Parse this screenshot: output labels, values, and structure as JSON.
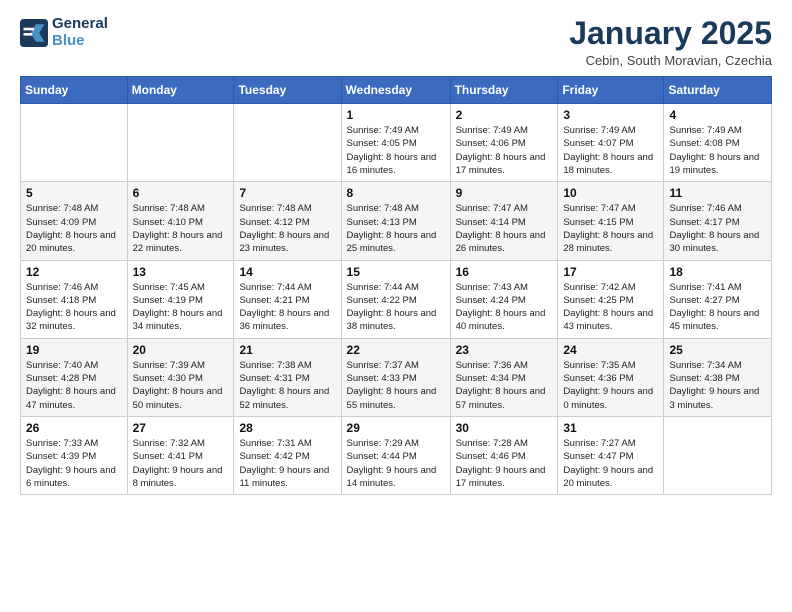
{
  "header": {
    "logo_line1": "General",
    "logo_line2": "Blue",
    "title": "January 2025",
    "subtitle": "Cebin, South Moravian, Czechia"
  },
  "weekdays": [
    "Sunday",
    "Monday",
    "Tuesday",
    "Wednesday",
    "Thursday",
    "Friday",
    "Saturday"
  ],
  "weeks": [
    [
      {
        "day": "",
        "sunrise": "",
        "sunset": "",
        "daylight": ""
      },
      {
        "day": "",
        "sunrise": "",
        "sunset": "",
        "daylight": ""
      },
      {
        "day": "",
        "sunrise": "",
        "sunset": "",
        "daylight": ""
      },
      {
        "day": "1",
        "sunrise": "Sunrise: 7:49 AM",
        "sunset": "Sunset: 4:05 PM",
        "daylight": "Daylight: 8 hours and 16 minutes."
      },
      {
        "day": "2",
        "sunrise": "Sunrise: 7:49 AM",
        "sunset": "Sunset: 4:06 PM",
        "daylight": "Daylight: 8 hours and 17 minutes."
      },
      {
        "day": "3",
        "sunrise": "Sunrise: 7:49 AM",
        "sunset": "Sunset: 4:07 PM",
        "daylight": "Daylight: 8 hours and 18 minutes."
      },
      {
        "day": "4",
        "sunrise": "Sunrise: 7:49 AM",
        "sunset": "Sunset: 4:08 PM",
        "daylight": "Daylight: 8 hours and 19 minutes."
      }
    ],
    [
      {
        "day": "5",
        "sunrise": "Sunrise: 7:48 AM",
        "sunset": "Sunset: 4:09 PM",
        "daylight": "Daylight: 8 hours and 20 minutes."
      },
      {
        "day": "6",
        "sunrise": "Sunrise: 7:48 AM",
        "sunset": "Sunset: 4:10 PM",
        "daylight": "Daylight: 8 hours and 22 minutes."
      },
      {
        "day": "7",
        "sunrise": "Sunrise: 7:48 AM",
        "sunset": "Sunset: 4:12 PM",
        "daylight": "Daylight: 8 hours and 23 minutes."
      },
      {
        "day": "8",
        "sunrise": "Sunrise: 7:48 AM",
        "sunset": "Sunset: 4:13 PM",
        "daylight": "Daylight: 8 hours and 25 minutes."
      },
      {
        "day": "9",
        "sunrise": "Sunrise: 7:47 AM",
        "sunset": "Sunset: 4:14 PM",
        "daylight": "Daylight: 8 hours and 26 minutes."
      },
      {
        "day": "10",
        "sunrise": "Sunrise: 7:47 AM",
        "sunset": "Sunset: 4:15 PM",
        "daylight": "Daylight: 8 hours and 28 minutes."
      },
      {
        "day": "11",
        "sunrise": "Sunrise: 7:46 AM",
        "sunset": "Sunset: 4:17 PM",
        "daylight": "Daylight: 8 hours and 30 minutes."
      }
    ],
    [
      {
        "day": "12",
        "sunrise": "Sunrise: 7:46 AM",
        "sunset": "Sunset: 4:18 PM",
        "daylight": "Daylight: 8 hours and 32 minutes."
      },
      {
        "day": "13",
        "sunrise": "Sunrise: 7:45 AM",
        "sunset": "Sunset: 4:19 PM",
        "daylight": "Daylight: 8 hours and 34 minutes."
      },
      {
        "day": "14",
        "sunrise": "Sunrise: 7:44 AM",
        "sunset": "Sunset: 4:21 PM",
        "daylight": "Daylight: 8 hours and 36 minutes."
      },
      {
        "day": "15",
        "sunrise": "Sunrise: 7:44 AM",
        "sunset": "Sunset: 4:22 PM",
        "daylight": "Daylight: 8 hours and 38 minutes."
      },
      {
        "day": "16",
        "sunrise": "Sunrise: 7:43 AM",
        "sunset": "Sunset: 4:24 PM",
        "daylight": "Daylight: 8 hours and 40 minutes."
      },
      {
        "day": "17",
        "sunrise": "Sunrise: 7:42 AM",
        "sunset": "Sunset: 4:25 PM",
        "daylight": "Daylight: 8 hours and 43 minutes."
      },
      {
        "day": "18",
        "sunrise": "Sunrise: 7:41 AM",
        "sunset": "Sunset: 4:27 PM",
        "daylight": "Daylight: 8 hours and 45 minutes."
      }
    ],
    [
      {
        "day": "19",
        "sunrise": "Sunrise: 7:40 AM",
        "sunset": "Sunset: 4:28 PM",
        "daylight": "Daylight: 8 hours and 47 minutes."
      },
      {
        "day": "20",
        "sunrise": "Sunrise: 7:39 AM",
        "sunset": "Sunset: 4:30 PM",
        "daylight": "Daylight: 8 hours and 50 minutes."
      },
      {
        "day": "21",
        "sunrise": "Sunrise: 7:38 AM",
        "sunset": "Sunset: 4:31 PM",
        "daylight": "Daylight: 8 hours and 52 minutes."
      },
      {
        "day": "22",
        "sunrise": "Sunrise: 7:37 AM",
        "sunset": "Sunset: 4:33 PM",
        "daylight": "Daylight: 8 hours and 55 minutes."
      },
      {
        "day": "23",
        "sunrise": "Sunrise: 7:36 AM",
        "sunset": "Sunset: 4:34 PM",
        "daylight": "Daylight: 8 hours and 57 minutes."
      },
      {
        "day": "24",
        "sunrise": "Sunrise: 7:35 AM",
        "sunset": "Sunset: 4:36 PM",
        "daylight": "Daylight: 9 hours and 0 minutes."
      },
      {
        "day": "25",
        "sunrise": "Sunrise: 7:34 AM",
        "sunset": "Sunset: 4:38 PM",
        "daylight": "Daylight: 9 hours and 3 minutes."
      }
    ],
    [
      {
        "day": "26",
        "sunrise": "Sunrise: 7:33 AM",
        "sunset": "Sunset: 4:39 PM",
        "daylight": "Daylight: 9 hours and 6 minutes."
      },
      {
        "day": "27",
        "sunrise": "Sunrise: 7:32 AM",
        "sunset": "Sunset: 4:41 PM",
        "daylight": "Daylight: 9 hours and 8 minutes."
      },
      {
        "day": "28",
        "sunrise": "Sunrise: 7:31 AM",
        "sunset": "Sunset: 4:42 PM",
        "daylight": "Daylight: 9 hours and 11 minutes."
      },
      {
        "day": "29",
        "sunrise": "Sunrise: 7:29 AM",
        "sunset": "Sunset: 4:44 PM",
        "daylight": "Daylight: 9 hours and 14 minutes."
      },
      {
        "day": "30",
        "sunrise": "Sunrise: 7:28 AM",
        "sunset": "Sunset: 4:46 PM",
        "daylight": "Daylight: 9 hours and 17 minutes."
      },
      {
        "day": "31",
        "sunrise": "Sunrise: 7:27 AM",
        "sunset": "Sunset: 4:47 PM",
        "daylight": "Daylight: 9 hours and 20 minutes."
      },
      {
        "day": "",
        "sunrise": "",
        "sunset": "",
        "daylight": ""
      }
    ]
  ]
}
